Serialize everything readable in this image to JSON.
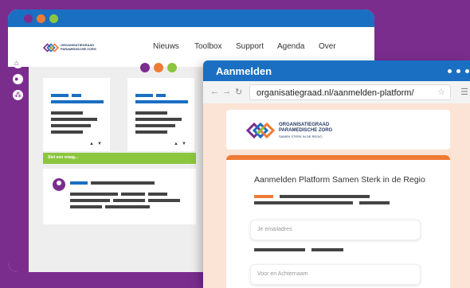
{
  "colors": {
    "brand_purple": "#7b2d8e",
    "brand_blue": "#1a6fc2",
    "brand_orange": "#f07b35",
    "brand_green": "#8cc63f",
    "page_peach": "#fbe4d6"
  },
  "back_window": {
    "window_controls": [
      "purple",
      "orange",
      "green"
    ],
    "nav": {
      "logo_line1": "ORGANISATIEGRAAD",
      "logo_line2": "PARAMEDISCHE ZORG",
      "items": [
        "Nieuws",
        "Toolbox",
        "Support",
        "Agenda",
        "Over"
      ]
    },
    "sidebar_icons": [
      "home-icon",
      "chat-icon",
      "network-icon"
    ],
    "news_banner": "Stel een vraag..."
  },
  "front_window": {
    "title": "Aanmelden",
    "address_bar": {
      "url": "organisatiegraad.nl/aanmelden-platform/",
      "icons": [
        "back-arrow-icon",
        "forward-arrow-icon",
        "reload-icon",
        "star-icon",
        "menu-icon"
      ]
    },
    "logo": {
      "line1": "ORGANISATIEGRAAD",
      "line2": "PARAMEDISCHE ZORG",
      "tagline": "SAMEN STERK IN DE REGIO"
    },
    "form": {
      "title": "Aanmelden Platform Samen Sterk in de Regio",
      "email_placeholder": "Je emailadres",
      "name_placeholder": "Voor en Achternaam"
    }
  }
}
